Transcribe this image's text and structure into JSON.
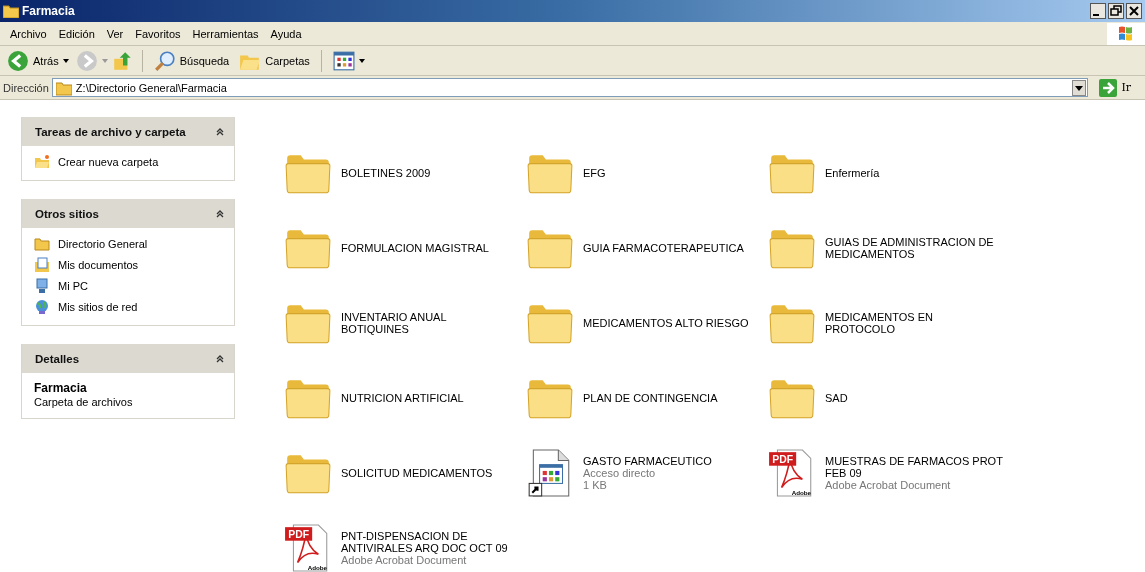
{
  "window": {
    "title": "Farmacia"
  },
  "menu": [
    "Archivo",
    "Edición",
    "Ver",
    "Favoritos",
    "Herramientas",
    "Ayuda"
  ],
  "toolbar": {
    "back": "Atrás",
    "search": "Búsqueda",
    "folders": "Carpetas"
  },
  "address": {
    "label": "Dirección",
    "value": "Z:\\Directorio General\\Farmacia",
    "go": "Ir"
  },
  "panels": [
    {
      "title": "Tareas de archivo y carpeta",
      "expanded": true,
      "kind": "links",
      "items": [
        {
          "label": "Crear nueva carpeta",
          "kind": "new-folder"
        }
      ]
    },
    {
      "title": "Otros sitios",
      "expanded": true,
      "kind": "links",
      "items": [
        {
          "label": "Directorio General",
          "kind": "folder"
        },
        {
          "label": "Mis documentos",
          "kind": "documents"
        },
        {
          "label": "Mi PC",
          "kind": "computer"
        },
        {
          "label": "Mis sitios de red",
          "kind": "network"
        }
      ]
    },
    {
      "title": "Detalles",
      "expanded": true,
      "kind": "details",
      "name": "Farmacia",
      "type": "Carpeta de archivos"
    }
  ],
  "files": [
    {
      "kind": "folder",
      "name": "BOLETINES 2009"
    },
    {
      "kind": "folder",
      "name": "EFG"
    },
    {
      "kind": "folder",
      "name": "Enfermería"
    },
    {
      "kind": "folder",
      "name": "FORMULACION MAGISTRAL"
    },
    {
      "kind": "folder",
      "name": "GUIA FARMACOTERAPEUTICA"
    },
    {
      "kind": "folder",
      "name": "GUIAS DE ADMINISTRACION DE\nMEDICAMENTOS"
    },
    {
      "kind": "folder",
      "name": "INVENTARIO ANUAL\nBOTIQUINES"
    },
    {
      "kind": "folder",
      "name": "MEDICAMENTOS ALTO RIESGO"
    },
    {
      "kind": "folder",
      "name": "MEDICAMENTOS EN\nPROTOCOLO"
    },
    {
      "kind": "folder",
      "name": "NUTRICION ARTIFICIAL"
    },
    {
      "kind": "folder",
      "name": "PLAN DE CONTINGENCIA"
    },
    {
      "kind": "folder",
      "name": "SAD"
    },
    {
      "kind": "folder",
      "name": "SOLICITUD MEDICAMENTOS"
    },
    {
      "kind": "shortcut",
      "name": "GASTO FARMACEUTICO",
      "details": [
        "Acceso directo",
        "1 KB"
      ]
    },
    {
      "kind": "pdf",
      "name": "MUESTRAS DE FARMACOS PROT\nFEB 09",
      "details": [
        "Adobe Acrobat Document"
      ],
      "icon_text": "PDF",
      "icon_brand": "Adobe"
    },
    {
      "kind": "pdf",
      "name": "PNT-DISPENSACION DE\nANTIVIRALES ARQ DOC OCT 09",
      "details": [
        "Adobe Acrobat Document"
      ],
      "icon_text": "PDF",
      "icon_brand": "Adobe"
    }
  ]
}
